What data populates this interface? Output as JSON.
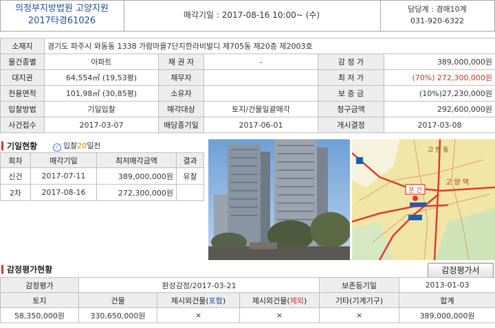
{
  "header": {
    "court_name": "의정부지방법원 고양지원",
    "case_number": "2017타경61026",
    "sale_date_text": "매각기일 : 2017-08-16   10:00~ (수)",
    "contact_dept": "담당계 : 경매10계",
    "contact_phone": "031-920-6322"
  },
  "info": {
    "address_label": "소재지",
    "address": "경기도 파주시 와동동 1338 가람마을7단지한라비발디 제705동 제20층 제2003호",
    "type_label": "물건종별",
    "type": "아파트",
    "creditor_label": "채 권 자",
    "creditor": "-",
    "appraisal_label": "감 정 가",
    "appraisal": "389,000,000원",
    "land_right_label": "대지권",
    "land_right": "64,554㎡ (19,53평)",
    "debtor_label": "채무자",
    "debtor": "",
    "min_price_label": "최 저 가",
    "min_price": "(70%) 272,300,000원",
    "area_label": "전용면적",
    "area": "101,98㎡ (30,85평)",
    "owner_label": "소유자",
    "owner": "",
    "deposit_label": "보 증 금",
    "deposit": "(10%)27,230,000원",
    "bid_method_label": "입찰방법",
    "bid_method": "기일입찰",
    "sale_target_label": "매각대상",
    "sale_target": "토지/건물일괄매각",
    "claim_label": "청구금액",
    "claim": "292,600,000원",
    "case_receipt_label": "사건접수",
    "case_receipt": "2017-03-07",
    "dividend_label": "배당종기일",
    "dividend": "2017-06-01",
    "start_label": "개시결정",
    "start": "2017-03-08"
  },
  "bidding": {
    "title": "기일현황",
    "badge_prefix": "입찰",
    "badge_days": "20",
    "badge_suffix": "일전",
    "columns": [
      "회차",
      "매각기일",
      "최저매각금액",
      "결과"
    ],
    "rows": [
      {
        "round": "신건",
        "date": "2017-07-11",
        "price": "389,000,000원",
        "result": "유찰"
      },
      {
        "round": "2차",
        "date": "2017-08-16",
        "price": "272,300,000원",
        "result": ""
      }
    ]
  },
  "map": {
    "label_station": "고 양 역",
    "label_marker": "본 건",
    "label_region": "고 란 동"
  },
  "appraisal": {
    "title": "감정평가현황",
    "button_label": "감정평가서",
    "header_label": "감정평가",
    "header_value": "환성감정/2017-03-21",
    "preserve_label": "보존등기일",
    "preserve_value": "2013-01-03",
    "columns": {
      "land": "토지",
      "building": "건물",
      "excl_in_prefix": "제시외건물(",
      "excl_in_word": "포함",
      "excl_out_prefix": "제시외건물(",
      "excl_out_word": "제외",
      "close": ")",
      "other": "기타(기계기구)",
      "total": "합계"
    },
    "values": {
      "land": "58,350,000원",
      "building": "330,650,000원",
      "excl_in": "×",
      "excl_out": "×",
      "other": "×",
      "total": "389,000,000원"
    }
  },
  "colors": {
    "court_blue": "#1d4b9a",
    "price_red": "#c0392b",
    "section_red": "#dd3333",
    "days_orange": "#d8840b"
  }
}
